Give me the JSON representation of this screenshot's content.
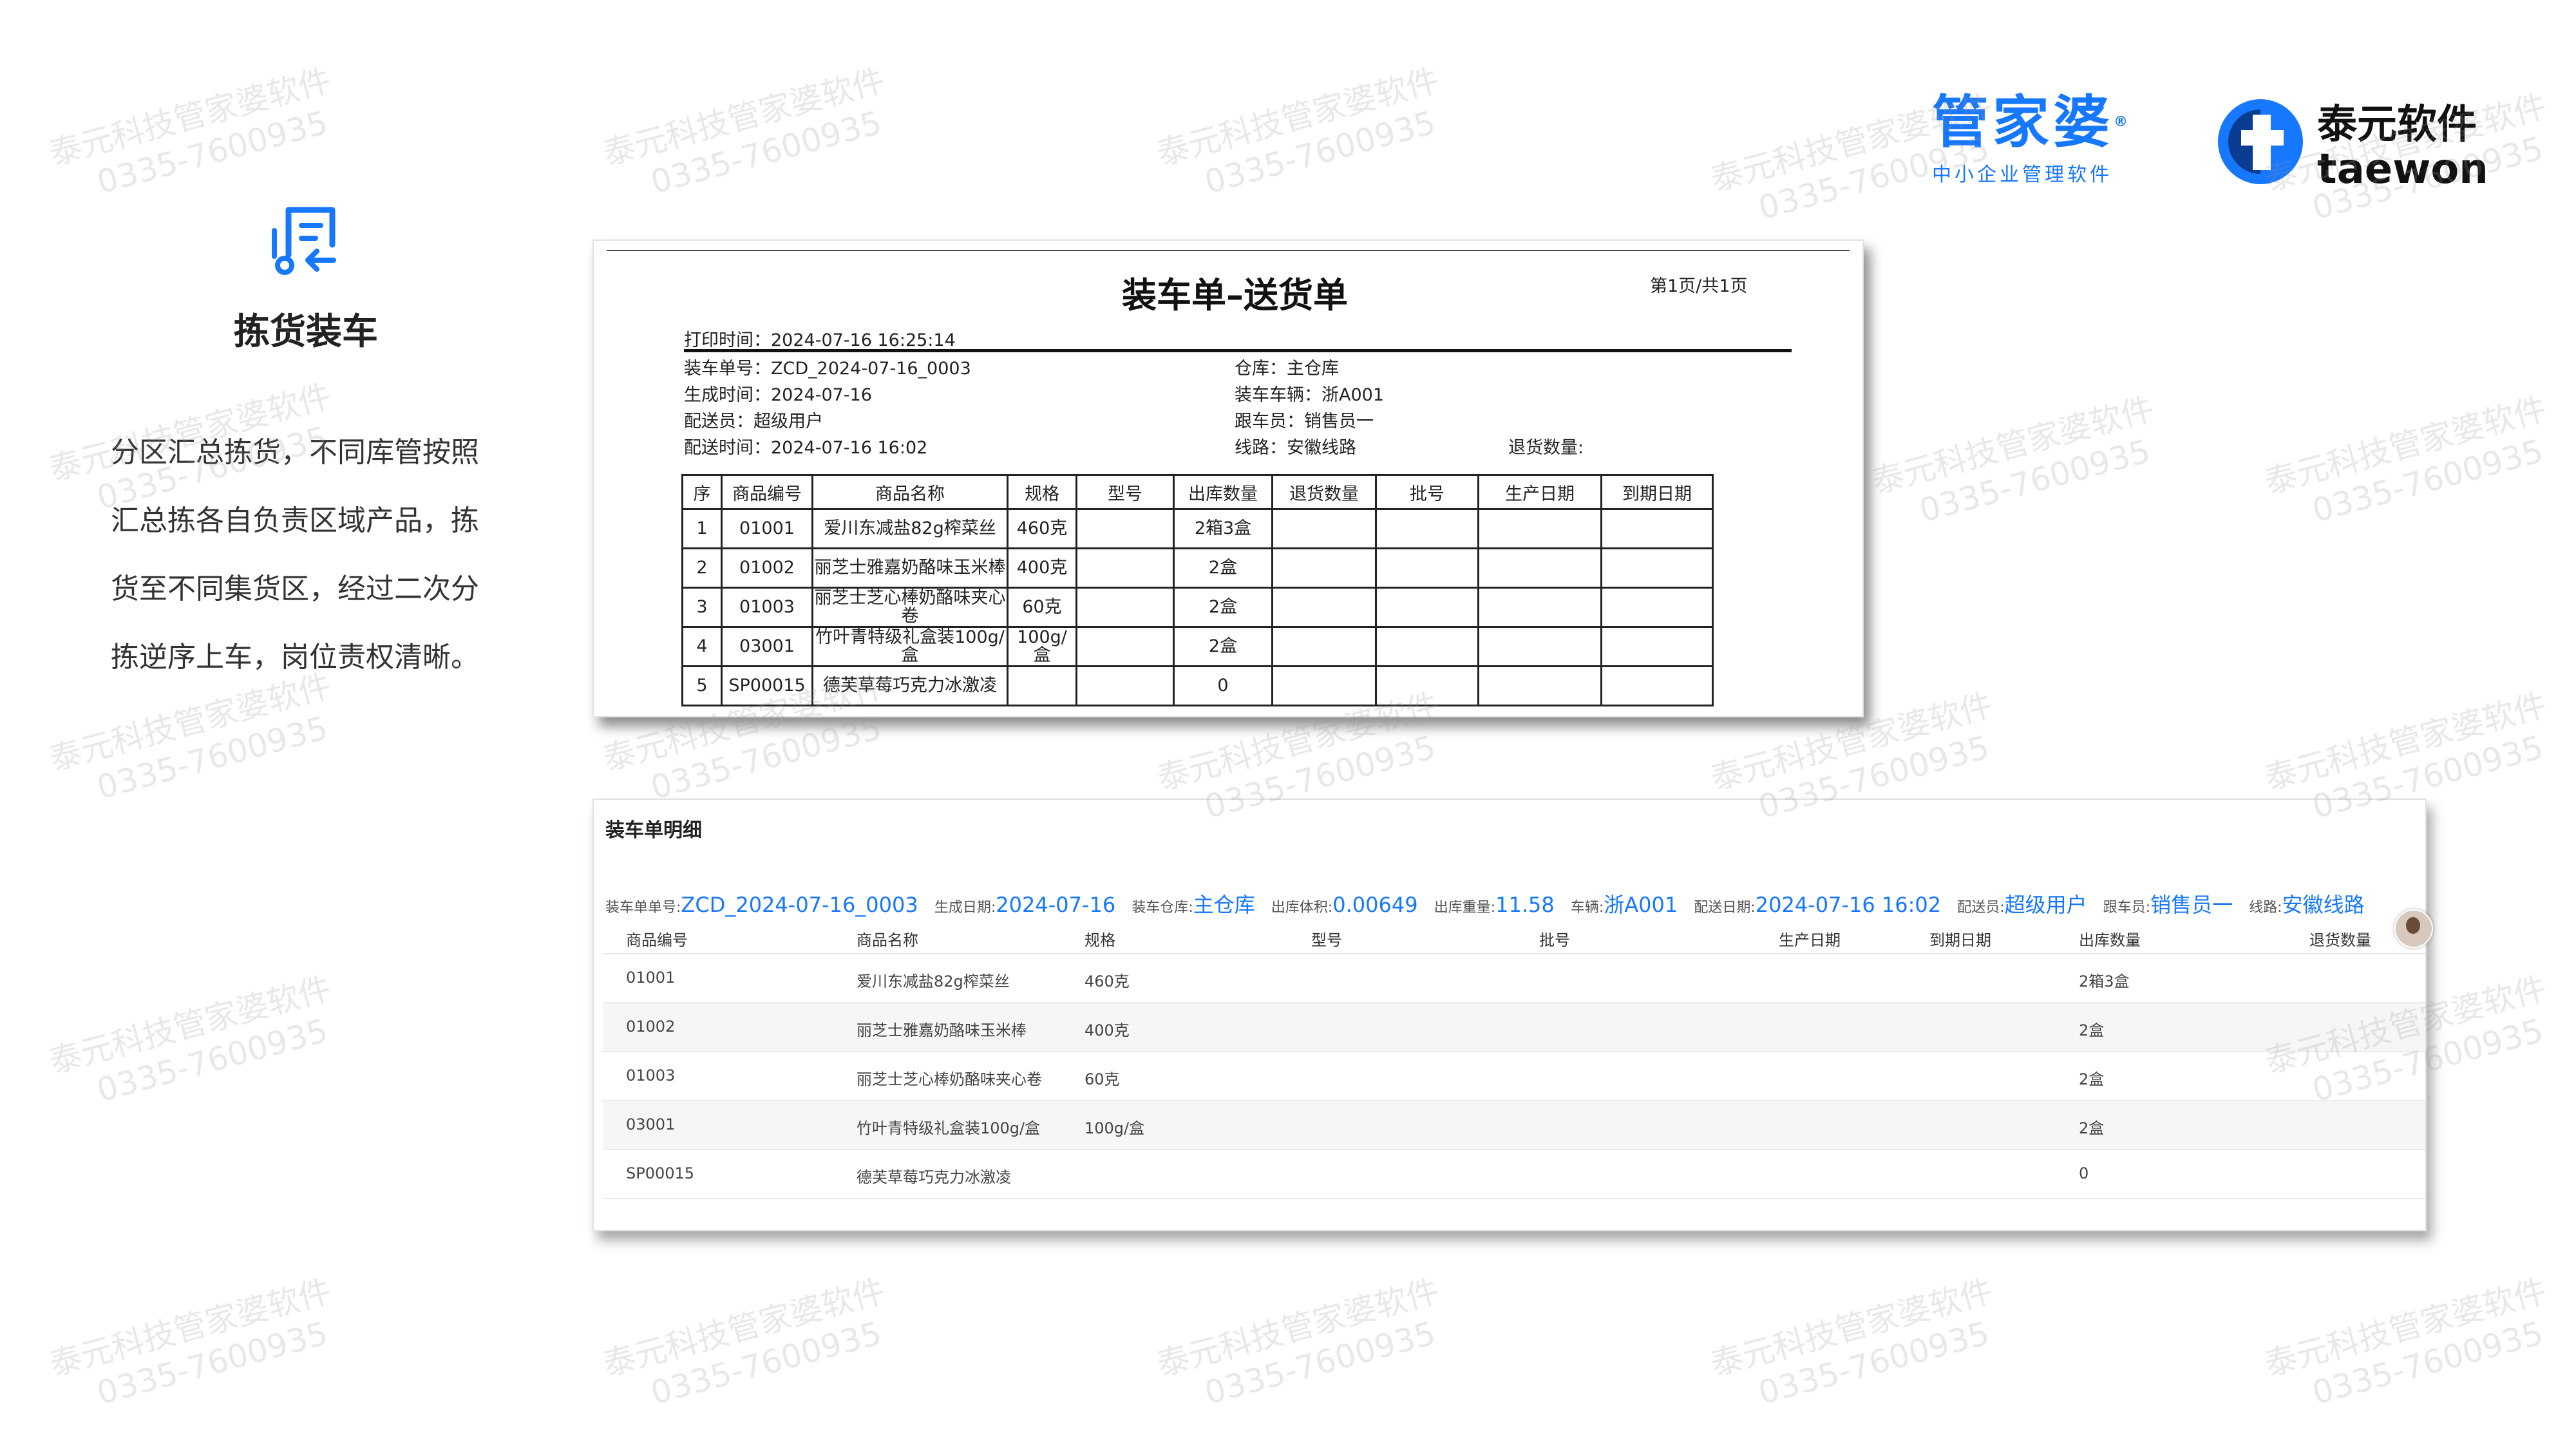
{
  "watermark": {
    "line1": "泰元科技管家婆软件",
    "line2": "0335-7600935"
  },
  "brand": {
    "guanjiapo_name": "管家婆",
    "guanjiapo_reg": "®",
    "guanjiapo_sub": "中小企业管理软件",
    "taewon_cn": "泰元软件",
    "taewon_en": "taewon"
  },
  "feature": {
    "title": "拣货装车",
    "desc": "分区汇总拣货，不同库管按照汇总拣各自负责区域产品，拣货至不同集货区，经过二次分拣逆序上车，岗位责权清晰。"
  },
  "print_doc": {
    "title": "装车单–送货单",
    "page_no": "第1页/共1页",
    "print_time": "打印时间：2024-07-16 16:25:14",
    "left_info": [
      "装车单号：ZCD_2024-07-16_0003",
      "生成时间：2024-07-16",
      "配送员：超级用户",
      "配送时间：2024-07-16 16:02"
    ],
    "right_info": [
      "仓库：主仓库",
      "装车车辆：浙A001",
      "跟车员：销售员一",
      "线路：安徽线路"
    ],
    "return_qty_label": "退货数量:",
    "columns": [
      "序",
      "商品编号",
      "商品名称",
      "规格",
      "型号",
      "出库数量",
      "退货数量",
      "批号",
      "生产日期",
      "到期日期"
    ],
    "rows": [
      [
        "1",
        "01001",
        "爱川东减盐82g榨菜丝",
        "460克",
        "",
        "2箱3盒",
        "",
        "",
        "",
        ""
      ],
      [
        "2",
        "01002",
        "丽芝士雅嘉奶酪味玉米棒",
        "400克",
        "",
        "2盒",
        "",
        "",
        "",
        ""
      ],
      [
        "3",
        "01003",
        "丽芝士芝心棒奶酪味夹心卷",
        "60克",
        "",
        "2盒",
        "",
        "",
        "",
        ""
      ],
      [
        "4",
        "03001",
        "竹叶青特级礼盒装100g/盒",
        "100g/盒",
        "",
        "2盒",
        "",
        "",
        "",
        ""
      ],
      [
        "5",
        "SP00015",
        "德芙草莓巧克力冰激凌",
        "",
        "",
        "0",
        "",
        "",
        "",
        ""
      ]
    ]
  },
  "detail": {
    "title": "装车单明细",
    "header": [
      {
        "label": "装车单单号:",
        "value": "ZCD_2024-07-16_0003"
      },
      {
        "label": "生成日期:",
        "value": "2024-07-16"
      },
      {
        "label": "装车仓库:",
        "value": "主仓库"
      },
      {
        "label": "出库体积:",
        "value": "0.00649"
      },
      {
        "label": "出库重量:",
        "value": "11.58"
      },
      {
        "label": "车辆:",
        "value": "浙A001"
      },
      {
        "label": "配送日期:",
        "value": "2024-07-16 16:02"
      },
      {
        "label": "配送员:",
        "value": "超级用户"
      },
      {
        "label": "跟车员:",
        "value": "销售员一"
      },
      {
        "label": "线路:",
        "value": "安徽线路"
      }
    ],
    "columns": [
      "商品编号",
      "商品名称",
      "规格",
      "型号",
      "批号",
      "生产日期",
      "到期日期",
      "出库数量",
      "退货数量"
    ],
    "rows": [
      [
        "01001",
        "爱川东减盐82g榨菜丝",
        "460克",
        "",
        "",
        "",
        "",
        "2箱3盒",
        ""
      ],
      [
        "01002",
        "丽芝士雅嘉奶酪味玉米棒",
        "400克",
        "",
        "",
        "",
        "",
        "2盒",
        ""
      ],
      [
        "01003",
        "丽芝士芝心棒奶酪味夹心卷",
        "60克",
        "",
        "",
        "",
        "",
        "2盒",
        ""
      ],
      [
        "03001",
        "竹叶青特级礼盒装100g/盒",
        "100g/盒",
        "",
        "",
        "",
        "",
        "2盒",
        ""
      ],
      [
        "SP00015",
        "德芙草莓巧克力冰激凌",
        "",
        "",
        "",
        "",
        "",
        "0",
        ""
      ]
    ]
  },
  "colors": {
    "accent": "#1677ff",
    "text": "#222222"
  },
  "icons": [
    "picking-list-icon",
    "taewon-logo-icon",
    "avatar"
  ]
}
